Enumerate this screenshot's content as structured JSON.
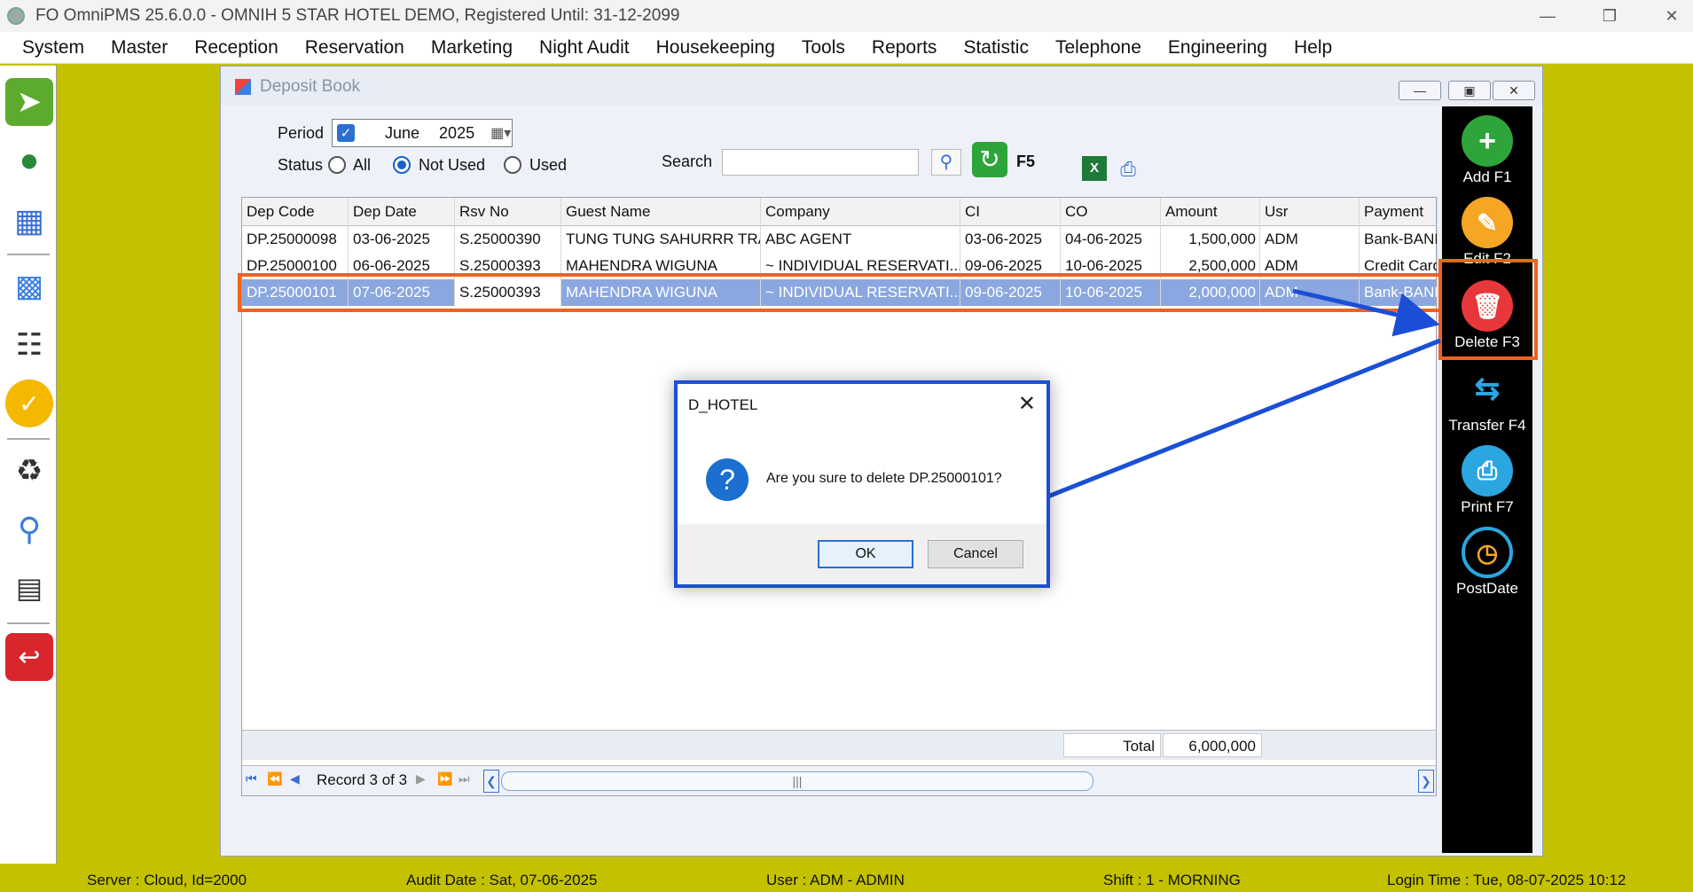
{
  "window": {
    "title": "FO OmniPMS 25.6.0.0 - OMNIH 5 STAR HOTEL DEMO, Registered Until: 31-12-2099"
  },
  "menu": [
    "System",
    "Master",
    "Reception",
    "Reservation",
    "Marketing",
    "Night Audit",
    "Housekeeping",
    "Tools",
    "Reports",
    "Statistic",
    "Telephone",
    "Engineering",
    "Help"
  ],
  "deposit_book": {
    "title": "Deposit Book",
    "period_label": "Period",
    "period_month": "June",
    "period_year": "2025",
    "status_label": "Status",
    "status_options": [
      "All",
      "Not Used",
      "Used"
    ],
    "status_selected": "Not Used",
    "search_label": "Search",
    "refresh_label": "F5",
    "columns": [
      "Dep Code",
      "Dep Date",
      "Rsv No",
      "Guest Name",
      "Company",
      "CI",
      "CO",
      "Amount",
      "Usr",
      "Payment"
    ],
    "rows": [
      [
        "DP.25000098",
        "03-06-2025",
        "S.25000390",
        "TUNG TUNG SAHURRR TRA...",
        "ABC AGENT",
        "03-06-2025",
        "04-06-2025",
        "1,500,000",
        "ADM",
        "Bank-BANK"
      ],
      [
        "DP.25000100",
        "06-06-2025",
        "S.25000393",
        "MAHENDRA WIGUNA",
        "~ INDIVIDUAL RESERVATI...",
        "09-06-2025",
        "10-06-2025",
        "2,500,000",
        "ADM",
        "Credit Card"
      ],
      [
        "DP.25000101",
        "07-06-2025",
        "S.25000393",
        "MAHENDRA WIGUNA",
        "~ INDIVIDUAL RESERVATI...",
        "09-06-2025",
        "10-06-2025",
        "2,000,000",
        "ADM",
        "Bank-BANK"
      ]
    ],
    "selected_row": 2,
    "total_label": "Total",
    "total_value": "6,000,000",
    "record_text": "Record 3 of 3"
  },
  "toolbar": {
    "add": "Add F1",
    "edit": "Edit F2",
    "delete": "Delete F3",
    "transfer": "Transfer F4",
    "print": "Print F7",
    "postdate": "PostDate"
  },
  "dialog": {
    "title": "D_HOTEL",
    "message": "Are you sure to delete DP.25000101?",
    "ok": "OK",
    "cancel": "Cancel"
  },
  "statusbar": {
    "server": "Server : Cloud, Id=2000",
    "audit_date": "Audit Date : Sat, 07-06-2025",
    "user": "User : ADM - ADMIN",
    "shift": "Shift : 1 - MORNING",
    "login_time": "Login Time : Tue, 08-07-2025 10:12"
  },
  "colors": {
    "background": "#c3c100",
    "highlight": "#f0621e",
    "arrow": "#1a4fd6",
    "selected_row": "#8ba7df"
  }
}
